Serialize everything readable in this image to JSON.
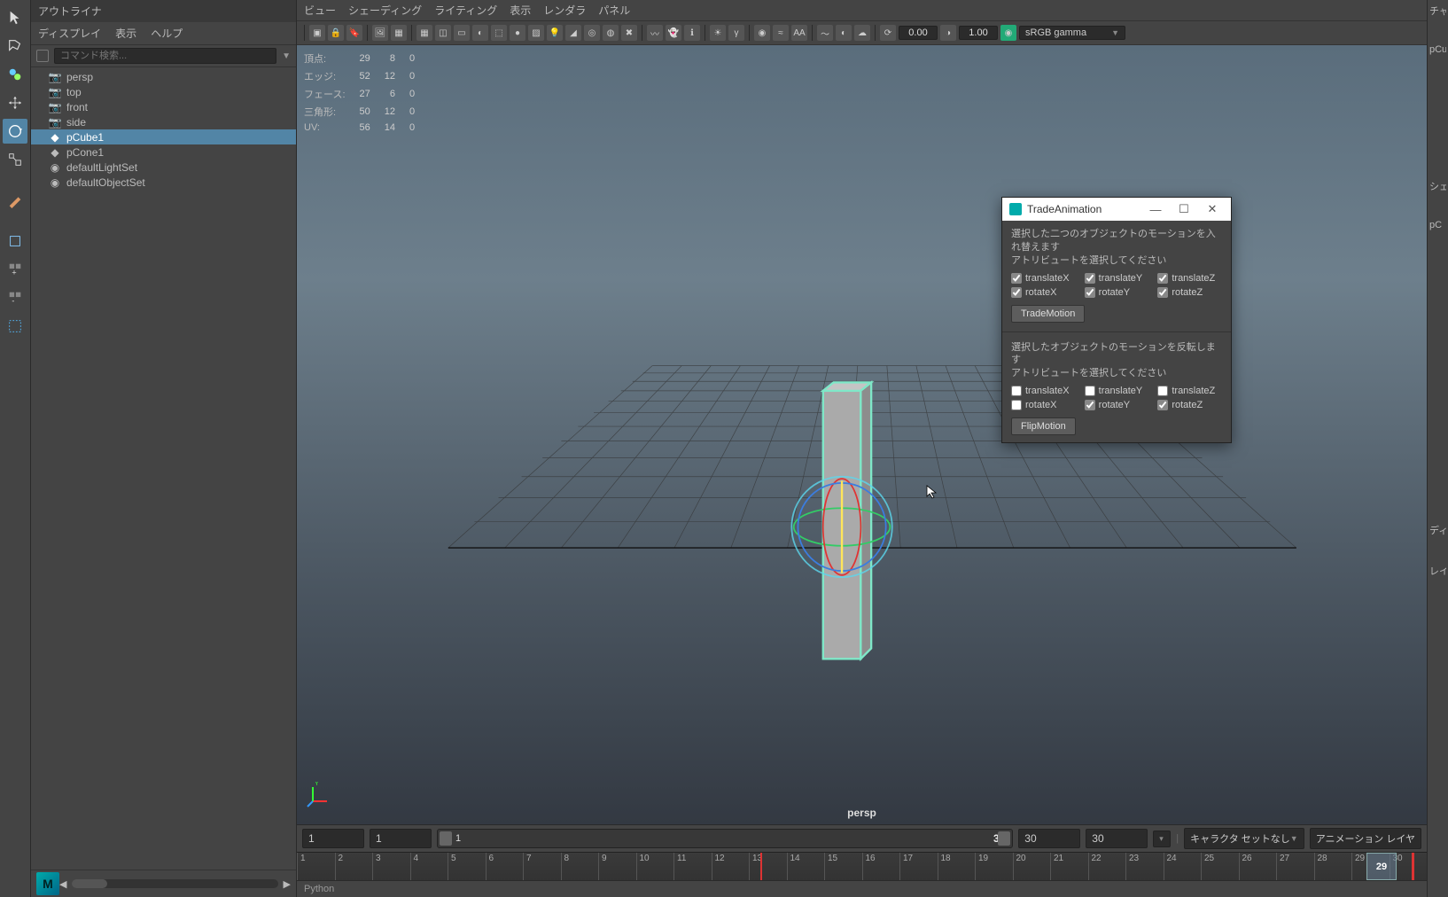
{
  "outliner": {
    "title": "アウトライナ",
    "menu": {
      "display": "ディスプレイ",
      "show": "表示",
      "help": "ヘルプ"
    },
    "search_placeholder": "コマンド検索...",
    "items": [
      {
        "name": "persp",
        "icon": "camera"
      },
      {
        "name": "top",
        "icon": "camera"
      },
      {
        "name": "front",
        "icon": "camera"
      },
      {
        "name": "side",
        "icon": "camera"
      },
      {
        "name": "pCube1",
        "icon": "mesh",
        "selected": true
      },
      {
        "name": "pCone1",
        "icon": "mesh"
      },
      {
        "name": "defaultLightSet",
        "icon": "set"
      },
      {
        "name": "defaultObjectSet",
        "icon": "set"
      }
    ]
  },
  "panel_menu": {
    "view": "ビュー",
    "shading": "シェーディング",
    "lighting": "ライティング",
    "show": "表示",
    "renderer": "レンダラ",
    "panels": "パネル"
  },
  "panel_toolbar": {
    "field1": "0.00",
    "field2": "1.00",
    "colorspace": "sRGB gamma"
  },
  "hud": {
    "rows": [
      {
        "label": "頂点:",
        "a": "29",
        "b": "8",
        "c": "0"
      },
      {
        "label": "エッジ:",
        "a": "52",
        "b": "12",
        "c": "0"
      },
      {
        "label": "フェース:",
        "a": "27",
        "b": "6",
        "c": "0"
      },
      {
        "label": "三角形:",
        "a": "50",
        "b": "12",
        "c": "0"
      },
      {
        "label": "UV:",
        "a": "56",
        "b": "14",
        "c": "0"
      }
    ],
    "camera": "persp"
  },
  "right": {
    "channel": "チャ",
    "object": "pCub",
    "shape": "シェイ",
    "shapeObj": "pC",
    "display": "ディ",
    "layer": "レイ"
  },
  "dialog": {
    "title": "TradeAnimation",
    "trade_instr": "選択した二つのオブジェクトのモーションを入れ替えます\nアトリビュートを選択してください",
    "flip_instr": "選択したオブジェクトのモーションを反転します\nアトリビュートを選択してください",
    "attrs": {
      "tx": "translateX",
      "ty": "translateY",
      "tz": "translateZ",
      "rx": "rotateX",
      "ry": "rotateY",
      "rz": "rotateZ"
    },
    "trade_btn": "TradeMotion",
    "flip_btn": "FlipMotion"
  },
  "timeslider": {
    "range_start": "1",
    "play_start": "1",
    "cur_display": "1",
    "range_end": "30",
    "play_end": "30",
    "play_end2": "30",
    "charset": "キャラクタ セットなし",
    "animlayer": "アニメーション レイヤ",
    "ticks": [
      "1",
      "2",
      "3",
      "4",
      "5",
      "6",
      "7",
      "8",
      "9",
      "10",
      "11",
      "12",
      "13",
      "14",
      "15",
      "16",
      "17",
      "18",
      "19",
      "20",
      "21",
      "22",
      "23",
      "24",
      "25",
      "26",
      "27",
      "28",
      "29",
      "30"
    ],
    "current_frame": "29"
  },
  "cmdline": {
    "lang": "Python"
  }
}
